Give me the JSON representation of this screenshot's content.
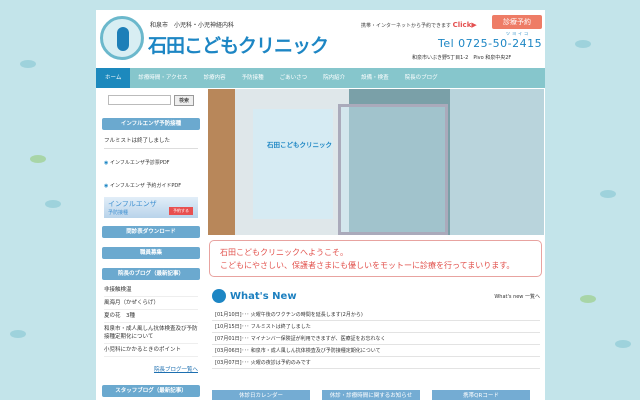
{
  "header": {
    "subtitle": "和泉市　小児科・小児神経内科",
    "clinic_name": "石田こどもクリニック",
    "reserve_note": "携帯・インターネットから予約できます",
    "click": "Click▶",
    "reserve_button": "診療予約",
    "tel_ruby": "ツヨイコ",
    "tel": "Tel 0725-50-2415",
    "address": "和泉市いぶき野5丁目1-2　Pivo 和泉中央2F"
  },
  "nav": [
    "ホーム",
    "診療時間・アクセス",
    "診療内容",
    "予防接種",
    "ごあいさつ",
    "院内紹介",
    "設備・検査",
    "院長のブログ"
  ],
  "sidebar": {
    "search_button": "検索",
    "influenza_header": "インフルエンザ予防接種",
    "influenza_text": "フルミストは終了しました",
    "pdf1": "インフルエンザ予診票PDF",
    "pdf2": "インフルエンザ 予約ガイドPDF",
    "banner_title": "インフルエンザ",
    "banner_sub": "予防接種",
    "banner_button": "予約する",
    "download": "問診表ダウンロード",
    "recruit": "職員募集",
    "blog_header": "院長のブログ（最新記事）",
    "blog_items": [
      "非接触検温",
      "風海月（かぜくらげ）",
      "夏の花　3種",
      "和泉市・成人風しん抗体検査及び予防接種定期化について",
      "小児科にかかるときのポイント"
    ],
    "blog_more": "院長ブログ一覧へ",
    "staff_header": "スタッフブログ（最新記事）"
  },
  "photo": {
    "sign": "石田こどもクリニック"
  },
  "welcome": {
    "line1": "石田こどもクリニックへようこそ。",
    "line2": "こどもにやさしい、保護者さまにも優しいをモットーに診療を行ってまいります。"
  },
  "whats_new": {
    "title": "What's New",
    "more": "What's new 一覧へ",
    "items": [
      "[01月10日]･･･ 火曜午後のワクチンの時間を延長します(2月から)",
      "[10月15日]･･･ フルミストは終了しました",
      "[07月01日]･･･ マイナンバー保険証が利用できますが、医療証をお忘れなく",
      "[03月06日]･･･ 和泉市・成人風しん抗体検査及び予防接種定期化について",
      "[03月07日]･･･ 火曜の夜診は予約のみです"
    ]
  },
  "bottom_buttons": [
    "休診日カレンダー",
    "休診・診療時間に関するお知らせ",
    "携帯QRコード"
  ]
}
